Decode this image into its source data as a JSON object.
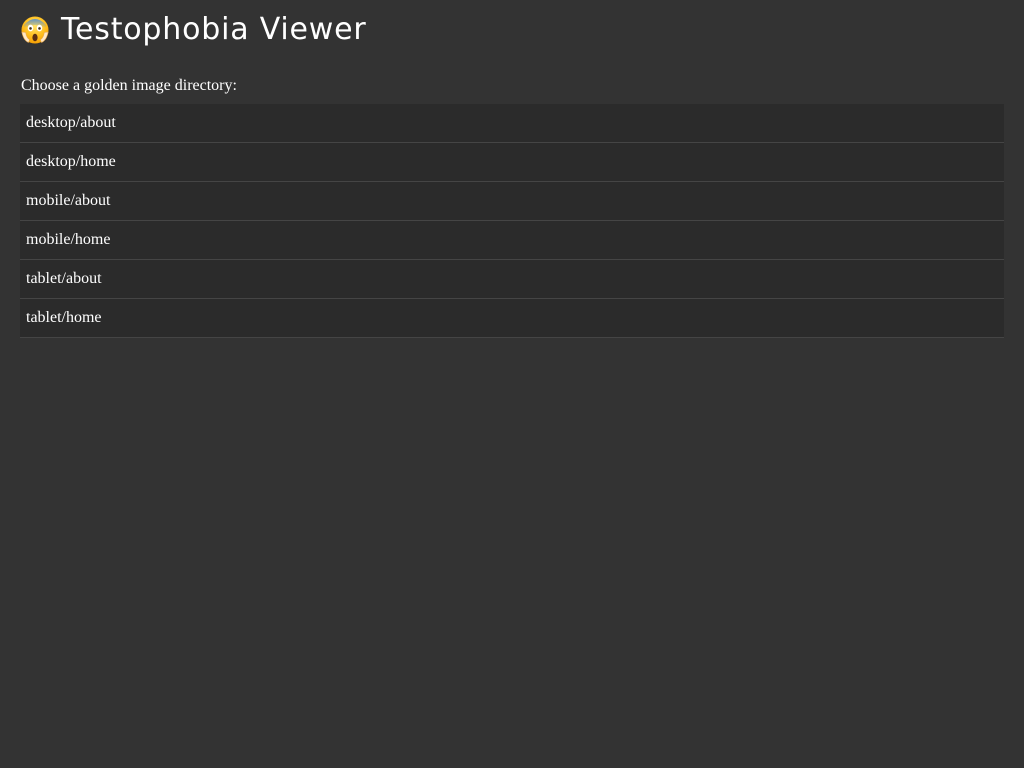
{
  "header": {
    "icon": "screaming-face-icon",
    "title": "Testophobia Viewer"
  },
  "prompt": "Choose a golden image directory:",
  "directories": [
    {
      "label": "desktop/about"
    },
    {
      "label": "desktop/home"
    },
    {
      "label": "mobile/about"
    },
    {
      "label": "mobile/home"
    },
    {
      "label": "tablet/about"
    },
    {
      "label": "tablet/home"
    }
  ],
  "colors": {
    "background": "#333333",
    "list_item_background": "#2b2b2b",
    "divider": "#454545",
    "text": "#ffffff"
  }
}
